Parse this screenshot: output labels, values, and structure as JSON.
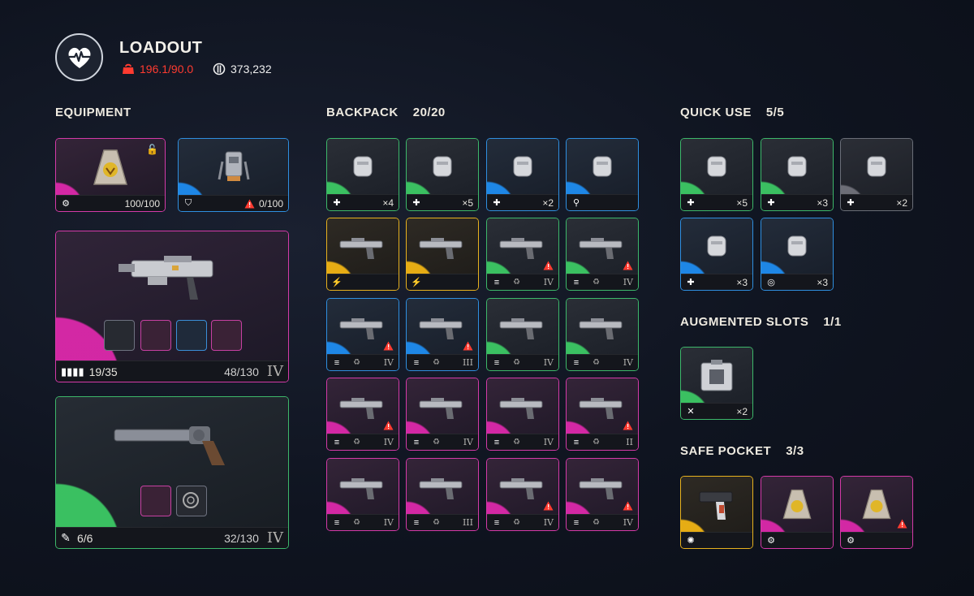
{
  "header": {
    "title": "LOADOUT",
    "weight": "196.1/90.0",
    "credits": "373,232",
    "colors": {
      "warning": "#ff3b30"
    }
  },
  "equipment": {
    "title": "EQUIPMENT",
    "shield": {
      "value": "100/100",
      "icon": "shield-pack-icon"
    },
    "augment": {
      "value": "0/100",
      "icon": "tech-backpack-icon"
    },
    "primary": {
      "ammo": "19/35",
      "reserve": "48/130",
      "tier": "IV"
    },
    "secondary": {
      "ammo": "6/6",
      "reserve": "32/130",
      "tier": "IV"
    }
  },
  "backpack": {
    "title": "BACKPACK",
    "count": "20/20",
    "slots": [
      {
        "rarity": "green",
        "icon": "medkit-icon",
        "qty": "×4"
      },
      {
        "rarity": "green",
        "icon": "medkit-icon",
        "qty": "×5"
      },
      {
        "rarity": "blue",
        "icon": "medkit-icon",
        "qty": "×2"
      },
      {
        "rarity": "blue",
        "icon": "wrench-icon",
        "qty": ""
      },
      {
        "rarity": "yellow",
        "icon": "lightning-icon",
        "qty": ""
      },
      {
        "rarity": "yellow",
        "icon": "lightning-icon",
        "qty": ""
      },
      {
        "rarity": "green",
        "icon": "ammo-icon",
        "tier": "IV",
        "warn": true
      },
      {
        "rarity": "green",
        "icon": "ammo-icon",
        "tier": "IV",
        "warn": true
      },
      {
        "rarity": "blue",
        "icon": "ammo-icon",
        "tier": "IV",
        "warn": true
      },
      {
        "rarity": "blue",
        "icon": "ammo-icon",
        "tier": "III",
        "warn": true
      },
      {
        "rarity": "green",
        "icon": "ammo-icon",
        "tier": "IV"
      },
      {
        "rarity": "green",
        "icon": "ammo-icon",
        "tier": "IV"
      },
      {
        "rarity": "pink",
        "icon": "ammo-icon",
        "tier": "IV",
        "warn": true
      },
      {
        "rarity": "pink",
        "icon": "ammo-icon",
        "tier": "IV"
      },
      {
        "rarity": "pink",
        "icon": "ammo-icon",
        "tier": "IV"
      },
      {
        "rarity": "pink",
        "icon": "ammo-icon",
        "tier": "II",
        "warn": true
      },
      {
        "rarity": "pink",
        "icon": "ammo-icon",
        "tier": "IV"
      },
      {
        "rarity": "pink",
        "icon": "ammo-icon",
        "tier": "III"
      },
      {
        "rarity": "pink",
        "icon": "ammo-icon",
        "tier": "IV",
        "warn": true
      },
      {
        "rarity": "pink",
        "icon": "ammo-icon",
        "tier": "IV",
        "warn": true
      }
    ]
  },
  "quick_use": {
    "title": "QUICK USE",
    "count": "5/5",
    "slots": [
      {
        "rarity": "green",
        "qty": "×5"
      },
      {
        "rarity": "green",
        "qty": "×3"
      },
      {
        "rarity": "gray",
        "qty": "×2"
      },
      {
        "rarity": "blue",
        "qty": "×3"
      },
      {
        "rarity": "blue",
        "qty": "×3"
      }
    ]
  },
  "augmented": {
    "title": "AUGMENTED SLOTS",
    "count": "1/1",
    "slot": {
      "rarity": "green",
      "qty": "×2"
    }
  },
  "safe_pocket": {
    "title": "SAFE POCKET",
    "count": "3/3"
  }
}
